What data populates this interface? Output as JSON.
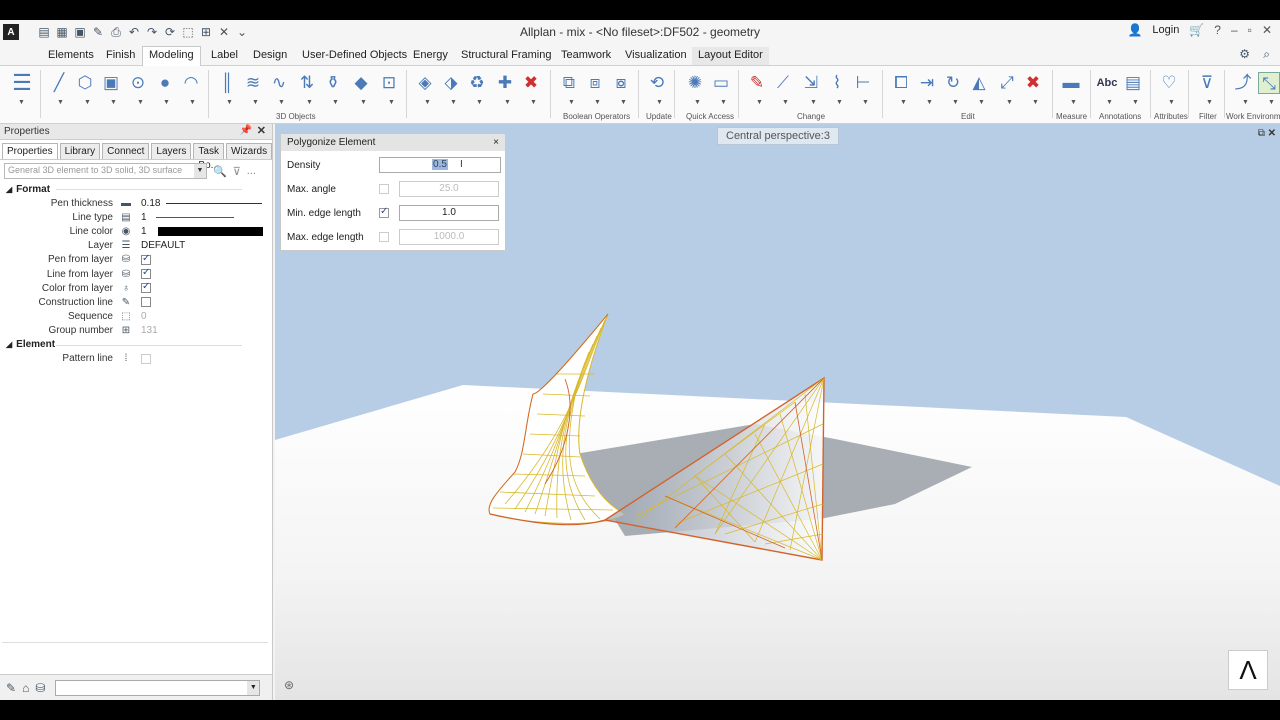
{
  "window": {
    "title": "Allplan - mix - <No fileset>:DF502 - geometry",
    "logo": "A",
    "login": "Login"
  },
  "menu": [
    "Elements",
    "Finish",
    "Modeling",
    "Label",
    "Design",
    "User-Defined Objects",
    "Energy",
    "Structural Framing",
    "Teamwork",
    "Visualization",
    "Layout Editor"
  ],
  "menu_active": "Modeling",
  "ribbon": {
    "groups": [
      "3D Objects",
      "Boolean Operators",
      "Update",
      "Quick Access",
      "Change",
      "Edit",
      "Measure",
      "Annotations",
      "Attributes",
      "Filter",
      "Work Environme"
    ],
    "measure_icon_text": "",
    "annotation_icon_text": "Abc"
  },
  "properties_panel": {
    "title": "Properties",
    "tabs": [
      "Properties",
      "Library",
      "Connect",
      "Layers",
      "Task Bo...",
      "Wizards"
    ],
    "filter_text": "General 3D element to 3D solid, 3D surface",
    "more": "...",
    "format_section": "Format",
    "element_section": "Element",
    "rows": {
      "pen_thickness": {
        "label": "Pen thickness",
        "value": "0.18"
      },
      "line_type": {
        "label": "Line type",
        "value": "1"
      },
      "line_color": {
        "label": "Line color",
        "value": "1"
      },
      "layer": {
        "label": "Layer",
        "value": "DEFAULT"
      },
      "pen_from_layer": {
        "label": "Pen from layer",
        "checked": true
      },
      "line_from_layer": {
        "label": "Line from layer",
        "checked": true
      },
      "color_from_layer": {
        "label": "Color from layer",
        "checked": true
      },
      "construction_line": {
        "label": "Construction line",
        "checked": false
      },
      "sequence": {
        "label": "Sequence",
        "value": "0"
      },
      "group_number": {
        "label": "Group number",
        "value": "131"
      },
      "pattern_line": {
        "label": "Pattern line",
        "checked": false
      }
    }
  },
  "viewport": {
    "view_label": "Central perspective:3",
    "brand": "Λ"
  },
  "dialog": {
    "title": "Polygonize Element",
    "close": "×",
    "density": {
      "label": "Density",
      "value": "0.5"
    },
    "max_angle": {
      "label": "Max. angle",
      "value": "25.0",
      "checked": false
    },
    "min_edge": {
      "label": "Min. edge length",
      "value": "1.0",
      "checked": true
    },
    "max_edge": {
      "label": "Max. edge length",
      "value": "1000.0",
      "checked": false
    }
  },
  "colors": {
    "sky": "#b7cde6",
    "ground": "#ffffff",
    "mesh_yellow": "#d8b82a",
    "mesh_orange": "#d2622a",
    "shadow": "#9aa0a8"
  }
}
